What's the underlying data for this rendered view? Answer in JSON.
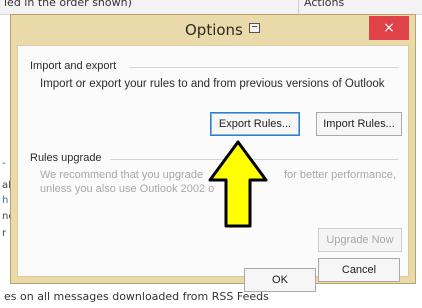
{
  "background": {
    "top_left_text": "led in the order shown)",
    "top_right_text": "Actions",
    "left_fragments": [
      "-",
      "al",
      "h",
      "ne",
      "r"
    ],
    "bottom_text": "es on all messages downloaded from RSS Feeds"
  },
  "dialog": {
    "title": "Options",
    "title_icon": "options-icon",
    "close_label": "×",
    "import_export": {
      "heading": "Import and export",
      "description": "Import or export your rules to and from previous versions of Outlook",
      "export_button": "Export Rules...",
      "import_button": "Import Rules..."
    },
    "rules_upgrade": {
      "heading": "Rules upgrade",
      "description_line1": "We recommend that you upgrade",
      "description_line1_end": "for better performance,",
      "description_line2": "unless you also use Outlook 2002 o",
      "upgrade_button": "Upgrade Now"
    },
    "ok_button": "OK",
    "cancel_button": "Cancel"
  },
  "overlay": {
    "arrow_color": "#ffff00",
    "arrow_outline": "#000000"
  }
}
